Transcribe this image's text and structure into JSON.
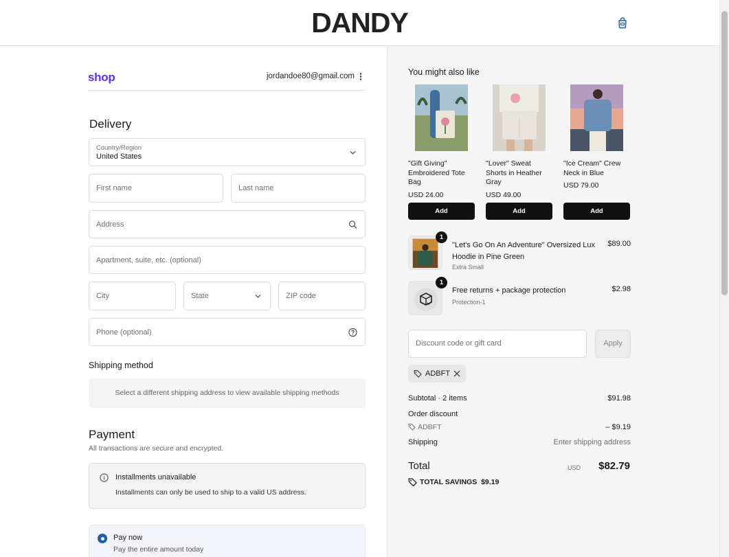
{
  "header": {
    "brand": "DANDY",
    "cart_icon": "shopping-bag-icon"
  },
  "account": {
    "shop_label": "shop",
    "email": "jordandoe80@gmail.com",
    "menu_icon": "more-vertical-icon"
  },
  "delivery": {
    "heading": "Delivery",
    "country_label": "Country/Region",
    "country_value": "United States",
    "first_name_placeholder": "First name",
    "last_name_placeholder": "Last name",
    "address_placeholder": "Address",
    "apartment_placeholder": "Apartment, suite, etc. (optional)",
    "city_placeholder": "City",
    "state_placeholder": "State",
    "zip_placeholder": "ZIP code",
    "phone_placeholder": "Phone (optional)"
  },
  "shipping": {
    "heading": "Shipping method",
    "message": "Select a different shipping address to view available shipping methods"
  },
  "payment": {
    "heading": "Payment",
    "subtitle": "All transactions are secure and encrypted.",
    "installments_title": "Installments unavailable",
    "installments_desc": "Installments can only be used to ship to a valid US address.",
    "pay_now_title": "Pay now",
    "pay_now_desc": "Pay the entire amount today"
  },
  "recommendations": {
    "heading": "You might also like",
    "items": [
      {
        "name": "\"Gift Giving\" Embroidered Tote Bag",
        "price": "USD 24.00",
        "add_label": "Add"
      },
      {
        "name": "\"Lover\" Sweat Shorts in Heather Gray",
        "price": "USD 49.00",
        "add_label": "Add"
      },
      {
        "name": "\"Ice Cream\" Crew Neck in Blue",
        "price": "USD 79.00",
        "add_label": "Add"
      }
    ]
  },
  "cart": {
    "items": [
      {
        "qty": "1",
        "name": "\"Let's Go On An Adventure\" Oversized Lux Hoodie in Pine Green",
        "variant": "Extra Small",
        "price": "$89.00"
      },
      {
        "qty": "1",
        "name": "Free returns + package protection",
        "variant": "Protection-1",
        "price": "$2.98"
      }
    ]
  },
  "discount": {
    "placeholder": "Discount code or gift card",
    "apply_label": "Apply",
    "applied_code": "ADBFT"
  },
  "summary": {
    "subtotal_label": "Subtotal · 2 items",
    "subtotal_value": "$91.98",
    "order_discount_label": "Order discount",
    "discount_code": "ADBFT",
    "discount_value": "– $9.19",
    "shipping_label": "Shipping",
    "shipping_value": "Enter shipping address",
    "total_label": "Total",
    "total_currency": "USD",
    "total_value": "$82.79",
    "savings_label": "TOTAL SAVINGS",
    "savings_value": "$9.19"
  },
  "colors": {
    "shop_purple": "#5a31f4",
    "radio_blue": "#1f5ea8",
    "button_black": "#111111"
  }
}
